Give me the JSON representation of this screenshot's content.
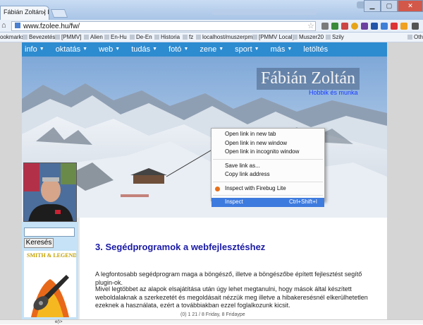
{
  "browser": {
    "tab_title": "Fábián Zoltán | Dobd el m",
    "url": "www.fzolee.hu/fw/",
    "bookmarks": [
      {
        "label": "ookmarks"
      },
      {
        "label": "Bevezetés"
      },
      {
        "label": "[PMMV]"
      },
      {
        "label": "Alien"
      },
      {
        "label": "En-Hu"
      },
      {
        "label": "De-En"
      },
      {
        "label": "Historia"
      },
      {
        "label": "fz"
      },
      {
        "label": "localhost/muszerpmm"
      },
      {
        "label": "[PMMV Local]"
      },
      {
        "label": "Muszer20"
      },
      {
        "label": "Szily"
      },
      {
        "label": "Othe"
      }
    ]
  },
  "site": {
    "nav": [
      {
        "label": "info"
      },
      {
        "label": "oktatás"
      },
      {
        "label": "web"
      },
      {
        "label": "tudás"
      },
      {
        "label": "fotó"
      },
      {
        "label": "zene"
      },
      {
        "label": "sport"
      },
      {
        "label": "más"
      },
      {
        "label": "letöltés"
      }
    ],
    "owner_name": "Fábián Zoltán",
    "subtitle": "Hobbik és munka",
    "search_button": "Keresés",
    "promo_title": "SMITH & LEGENDS"
  },
  "content": {
    "heading": "3. Segédprogramok a webfejlesztéshez",
    "para1": "A legfontosabb segédprogram maga a böngésző, illetve a böngészőbe épített fejlesztést segítő plugin-ok.",
    "para2": "Mivel legtöbbet az alapok elsajátítása után úgy lehet megtanulni, hogy mások által készített weboldalaknak a szerkezetét és megoldásait nézzük meg illetve a hibakeresésnél elkerülhetetlen ezeknek a használata, ezért a továbbiakban ezzel foglalkozunk kicsit."
  },
  "context_menu": {
    "open_new_tab": "Open link in new tab",
    "open_new_window": "Open link in new window",
    "open_incognito": "Open link in incognito window",
    "save_link": "Save link as...",
    "copy_link": "Copy link address",
    "inspect_firebug": "Inspect with Firebug Lite",
    "inspect": "Inspect",
    "inspect_shortcut": "Ctrl+Shift+I"
  },
  "status": {
    "left": "e(\\>",
    "right": "(0) 1 21 / 8 Friday, 8 Fridaype"
  },
  "colors": {
    "nav_bg": "#2d8bd0",
    "heading": "#1a1aa6",
    "menu_highlight": "#3e7bde",
    "sidebar_bg": "#c5e2f6"
  }
}
